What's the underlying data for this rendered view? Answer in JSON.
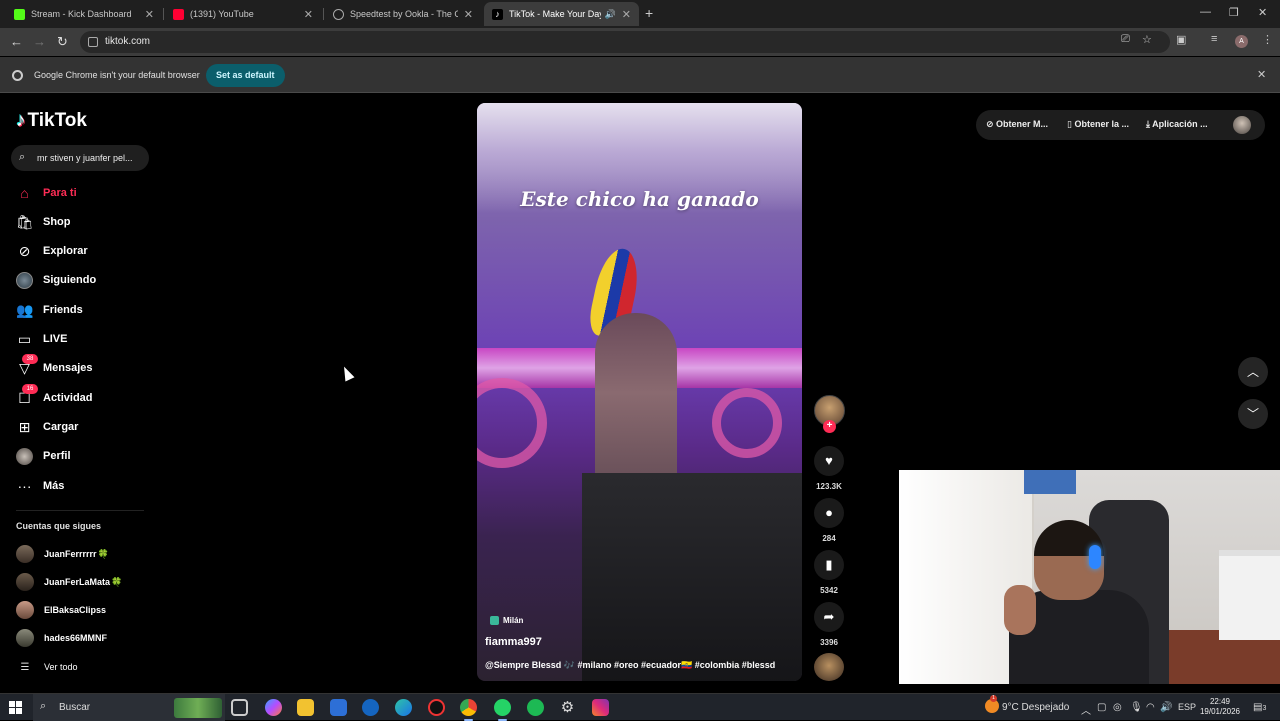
{
  "browser": {
    "tabs": [
      {
        "title": "Stream - Kick Dashboard",
        "favicon_color": "#53fc18",
        "active": false
      },
      {
        "title": "(1391) YouTube",
        "favicon_color": "#ff0033",
        "active": false
      },
      {
        "title": "Speedtest by Ookla - The Global",
        "favicon_color": "#1d1d1d",
        "active": false
      },
      {
        "title": "TikTok - Make Your Day",
        "favicon_color": "#000000",
        "active": true
      }
    ],
    "url": "tiktok.com",
    "infobar": {
      "message": "Google Chrome isn't your default browser",
      "button": "Set as default"
    }
  },
  "tiktok": {
    "logo": "TikTok",
    "search_value": "mr stiven y juanfer pel...",
    "nav": [
      {
        "label": "Para ti",
        "icon": "home-icon",
        "active": true
      },
      {
        "label": "Shop",
        "icon": "shop-icon"
      },
      {
        "label": "Explorar",
        "icon": "compass-icon"
      },
      {
        "label": "Siguiendo",
        "icon": "following-avatar"
      },
      {
        "label": "Friends",
        "icon": "friends-icon"
      },
      {
        "label": "LIVE",
        "icon": "live-icon"
      },
      {
        "label": "Mensajes",
        "icon": "messages-icon",
        "badge": "38"
      },
      {
        "label": "Actividad",
        "icon": "activity-icon",
        "badge": "16"
      },
      {
        "label": "Cargar",
        "icon": "upload-icon"
      },
      {
        "label": "Perfil",
        "icon": "profile-avatar"
      },
      {
        "label": "Más",
        "icon": "more-icon"
      }
    ],
    "following_title": "Cuentas que sigues",
    "following": [
      {
        "name": "JuanFerrrrrr",
        "clover": "🍀"
      },
      {
        "name": "JuanFerLaMata",
        "clover": "🍀"
      },
      {
        "name": "ElBaksaClipss",
        "clover": ""
      },
      {
        "name": "hades66MMNF",
        "clover": ""
      }
    ],
    "see_all": "Ver todo",
    "video": {
      "caption": "Este chico ha ganado",
      "location": "Milán",
      "author": "fiamma997",
      "description": "@Siempre Blessd 🎶 #milano #oreo #ecuador🇪🇨 #colombia #blessd"
    },
    "actions": {
      "likes": "123.3K",
      "comments": "284",
      "saves": "5342",
      "shares": "3396"
    },
    "header": {
      "item1": "Obtener M...",
      "item2": "Obtener la ...",
      "item3": "Aplicación ..."
    }
  },
  "taskbar": {
    "search": "Buscar",
    "weather": "9°C  Despejado",
    "weather_badge": "1",
    "lang": "ESP",
    "time": "22:49",
    "date": "19/01/2026",
    "notif_count": "3"
  },
  "colors": {
    "accent": "#fe2c55",
    "chrome_dark": "#1f1f1f"
  }
}
